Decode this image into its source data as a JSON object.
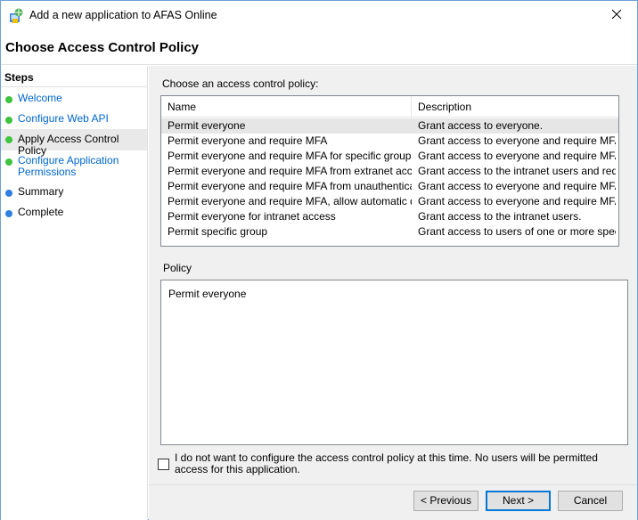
{
  "window": {
    "title": "Add a new application to AFAS Online",
    "icon": "adfs-app-icon",
    "close_glyph": "✕"
  },
  "header": {
    "title": "Choose Access Control Policy"
  },
  "steps": {
    "title": "Steps",
    "items": [
      {
        "label": "Welcome",
        "status": "done",
        "color": "#3ec43e"
      },
      {
        "label": "Configure Web API",
        "status": "done",
        "color": "#3ec43e"
      },
      {
        "label": "Apply Access Control Policy",
        "status": "current",
        "color": "#3ec43e"
      },
      {
        "label": "Configure Application Permissions",
        "status": "done",
        "color": "#3ec43e"
      },
      {
        "label": "Summary",
        "status": "pending",
        "color": "#2f7fe0"
      },
      {
        "label": "Complete",
        "status": "pending",
        "color": "#2f7fe0"
      }
    ]
  },
  "policy_list": {
    "label": "Choose an access control policy:",
    "columns": [
      "Name",
      "Description"
    ],
    "rows": [
      {
        "name": "Permit everyone",
        "description": "Grant access to everyone.",
        "selected": true
      },
      {
        "name": "Permit everyone and require MFA",
        "description": "Grant access to everyone and require MFA f..."
      },
      {
        "name": "Permit everyone and require MFA for specific group",
        "description": "Grant access to everyone and require MFA f..."
      },
      {
        "name": "Permit everyone and require MFA from extranet access",
        "description": "Grant access to the intranet users and requir..."
      },
      {
        "name": "Permit everyone and require MFA from unauthenticated ...",
        "description": "Grant access to everyone and require MFA f..."
      },
      {
        "name": "Permit everyone and require MFA, allow automatic devi...",
        "description": "Grant access to everyone and require MFA f..."
      },
      {
        "name": "Permit everyone for intranet access",
        "description": "Grant access to the intranet users."
      },
      {
        "name": "Permit specific group",
        "description": "Grant access to users of one or more specifi..."
      }
    ]
  },
  "policy": {
    "label": "Policy",
    "text": "Permit everyone"
  },
  "skip_checkbox": {
    "checked": false,
    "label": "I do not want to configure the access control policy at this time.  No users will be permitted access for this application."
  },
  "buttons": {
    "previous": "< Previous",
    "next": "Next >",
    "cancel": "Cancel"
  }
}
